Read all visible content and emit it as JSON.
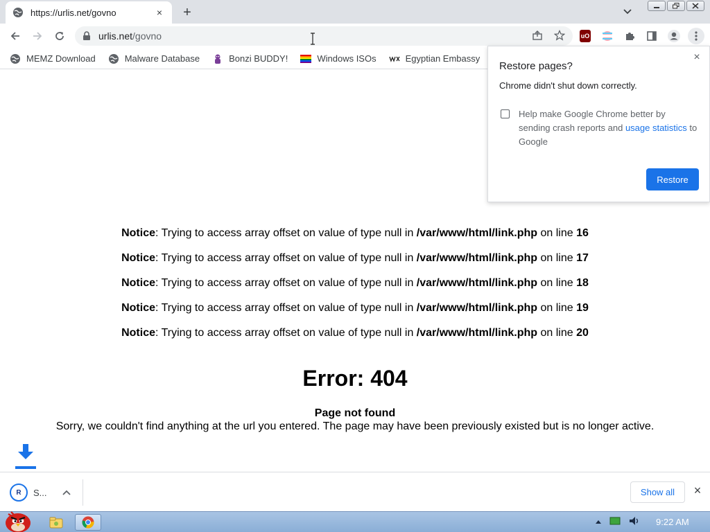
{
  "tab": {
    "title": "https://urlis.net/govno",
    "close_label": "×",
    "new_tab_label": "+"
  },
  "omnibox": {
    "host": "urlis.net",
    "path": "/govno"
  },
  "bookmarks": [
    {
      "label": "MEMZ Download",
      "icon": "globe-icon"
    },
    {
      "label": "Malware Database",
      "icon": "globe-icon"
    },
    {
      "label": "Bonzi BUDDY!",
      "icon": "bonzi-icon"
    },
    {
      "label": "Windows ISOs",
      "icon": "rainbow-flag-icon"
    },
    {
      "label": "Egyptian Embassy",
      "icon": "wix-icon"
    }
  ],
  "notices": [
    {
      "label": "Notice",
      "text": ": Trying to access array offset on value of type null in ",
      "file": "/var/www/html/link.php",
      "on_line": " on line ",
      "line": "16"
    },
    {
      "label": "Notice",
      "text": ": Trying to access array offset on value of type null in ",
      "file": "/var/www/html/link.php",
      "on_line": " on line ",
      "line": "17"
    },
    {
      "label": "Notice",
      "text": ": Trying to access array offset on value of type null in ",
      "file": "/var/www/html/link.php",
      "on_line": " on line ",
      "line": "18"
    },
    {
      "label": "Notice",
      "text": ": Trying to access array offset on value of type null in ",
      "file": "/var/www/html/link.php",
      "on_line": " on line ",
      "line": "19"
    },
    {
      "label": "Notice",
      "text": ": Trying to access array offset on value of type null in ",
      "file": "/var/www/html/link.php",
      "on_line": " on line ",
      "line": "20"
    }
  ],
  "error": {
    "title": "Error: 404",
    "subtitle": "Page not found",
    "description": "Sorry, we couldn't find anything at the url you entered. The page may have been previously existed but is no longer active."
  },
  "restore_popup": {
    "title": "Restore pages?",
    "message": "Chrome didn't shut down correctly.",
    "checkbox_text_1": "Help make Google Chrome better by sending crash reports and ",
    "checkbox_link": "usage statistics",
    "checkbox_text_2": " to Google",
    "checkbox_checked": false,
    "restore_label": "Restore",
    "close_label": "×"
  },
  "download_shelf": {
    "item_name": "S...",
    "show_all_label": "Show all",
    "close_label": "×"
  },
  "taskbar": {
    "clock": "9:22 AM"
  },
  "colors": {
    "accent": "#1a73e8",
    "tabstrip": "#dee1e6",
    "taskbar": "#a9c4e4"
  }
}
